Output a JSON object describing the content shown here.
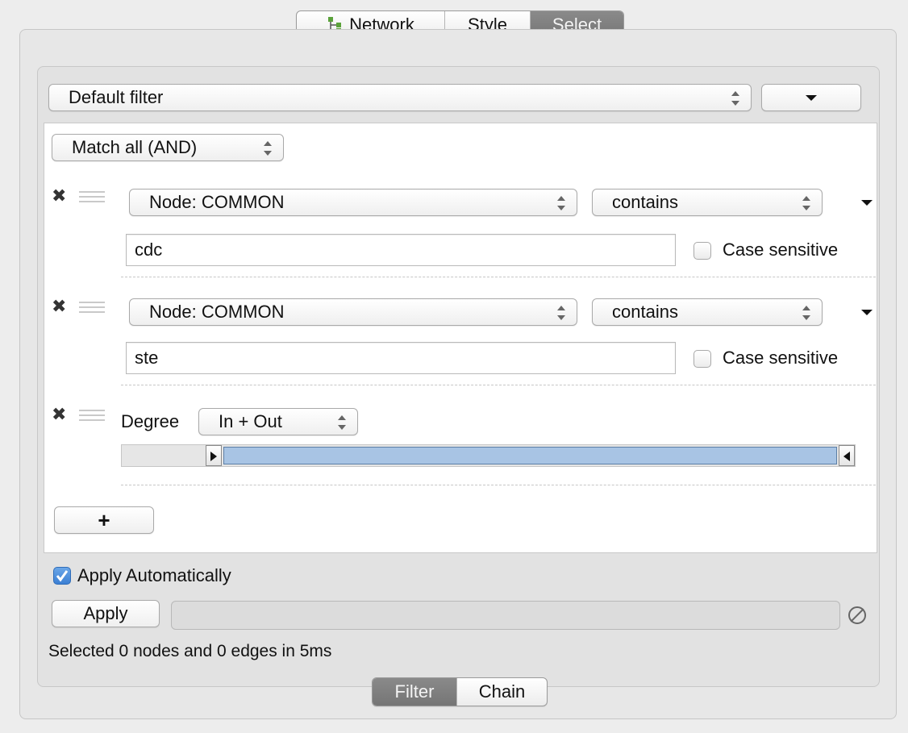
{
  "tabs": {
    "network": "Network",
    "style": "Style",
    "select": "Select",
    "active": "Select"
  },
  "filter_selector": {
    "value": "Default filter"
  },
  "match_mode": "Match all (AND)",
  "conditions": [
    {
      "attribute": "Node: COMMON",
      "operator": "contains",
      "value": "cdc",
      "case_sensitive_label": "Case sensitive",
      "case_sensitive": false
    },
    {
      "attribute": "Node: COMMON",
      "operator": "contains",
      "value": "ste",
      "case_sensitive_label": "Case sensitive",
      "case_sensitive": false
    }
  ],
  "degree": {
    "label": "Degree",
    "mode": "In + Out"
  },
  "add_button": "+",
  "apply_automatically": {
    "label": "Apply Automatically",
    "checked": true
  },
  "apply_button": "Apply",
  "status": "Selected 0 nodes and 0 edges in 5ms",
  "bottom_tabs": {
    "filter": "Filter",
    "chain": "Chain",
    "active": "Filter"
  },
  "colors": {
    "active_tab": "#7f7f7f",
    "slider_fill": "#a8c4e4",
    "checkbox_checked": "#3b7fd4"
  },
  "icons": {
    "network_tab": "network-tree-icon",
    "remove": "close-x-icon",
    "drag": "grip-icon",
    "menu": "triangle-down-icon",
    "cancel": "cancel-circle-icon"
  }
}
